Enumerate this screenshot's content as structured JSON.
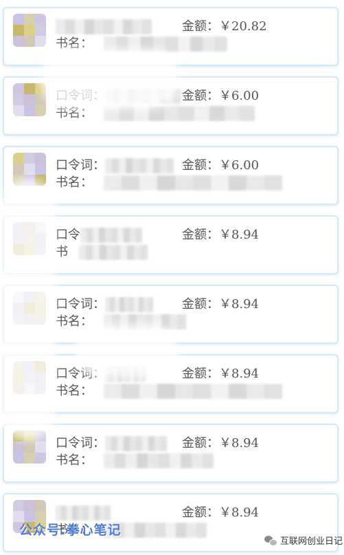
{
  "orders": [
    {
      "code_label": "",
      "book_label": "书名：",
      "amount_label": "金额：",
      "amount": "￥20.82"
    },
    {
      "code_label": "口令词：",
      "book_label": "书名：",
      "amount_label": "金额：",
      "amount": "￥6.00"
    },
    {
      "code_label": "口令词：",
      "book_label": "书名：",
      "amount_label": "金额：",
      "amount": "￥6.00"
    },
    {
      "code_label": "口令",
      "book_label": "书",
      "amount_label": "金额：",
      "amount": "￥8.94"
    },
    {
      "code_label": "口令词：",
      "book_label": "书名：",
      "amount_label": "金额：",
      "amount": "￥8.94"
    },
    {
      "code_label": "口令词：",
      "book_label": "书名：",
      "amount_label": "金额：",
      "amount": "￥8.94"
    },
    {
      "code_label": "口令词：",
      "book_label": "书名：",
      "amount_label": "金额：",
      "amount": "￥8.94"
    },
    {
      "code_label": "",
      "book_label": "书名：",
      "amount_label": "金额：",
      "amount": "￥8.94"
    }
  ],
  "watermark": {
    "left": "公众号:拳心笔记",
    "right": "互联网创业日记",
    "right_icon": "wechat-icon"
  },
  "colors": {
    "card_border": "#d4e8f6",
    "text": "#555555",
    "watermark_left": "#4f7bd9"
  }
}
